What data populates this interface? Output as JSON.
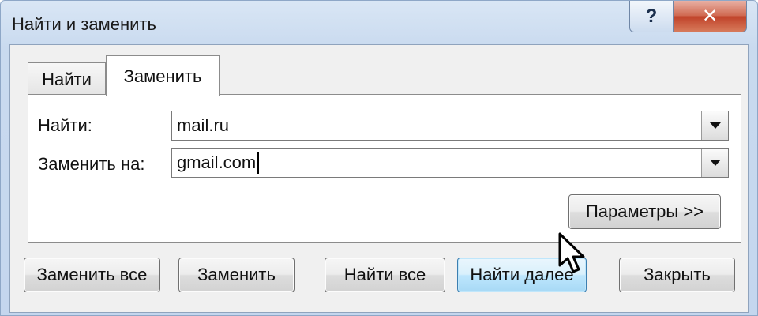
{
  "window": {
    "title": "Найти и заменить",
    "help_label": "?",
    "close_label": "✕"
  },
  "tabs": [
    {
      "label": "Найти",
      "selected": false
    },
    {
      "label": "Заменить",
      "selected": true
    }
  ],
  "find": {
    "label": "Найти:",
    "value": "mail.ru"
  },
  "replace": {
    "label": "Заменить на:",
    "value": "gmail.com"
  },
  "options_button": "Параметры >>",
  "buttons": {
    "replace_all": "Заменить все",
    "replace": "Заменить",
    "find_all": "Найти все",
    "find_next": "Найти далее",
    "close": "Закрыть"
  },
  "icons": {
    "dropdown": "chevron-down-icon",
    "pointer": "mouse-pointer-icon"
  },
  "colors": {
    "default_button": "#bee6fd",
    "close_button": "#c0432a",
    "title_bar": "#c9daef"
  }
}
